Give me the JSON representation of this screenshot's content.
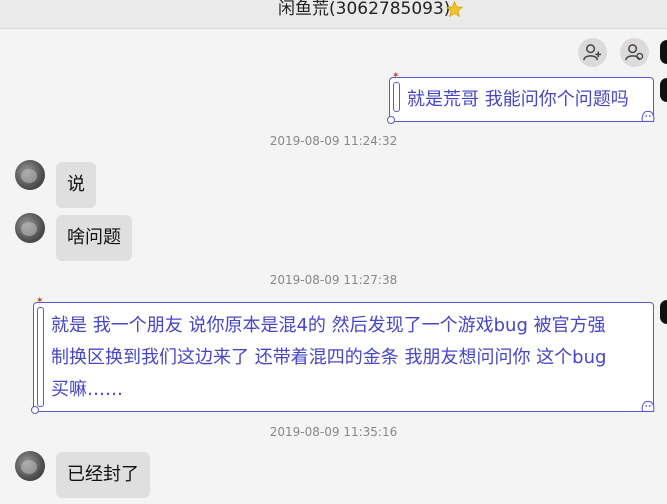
{
  "window": {
    "title": "闲鱼荒(3062785093)",
    "colors": {
      "accent": "#5959d0",
      "text_out": "#4646c8",
      "bubble_in": "#e0dfdf",
      "background": "#f5f4f4"
    }
  },
  "toolbar": {
    "icons": [
      "add-member-icon",
      "group-settings-icon"
    ]
  },
  "messages": [
    {
      "kind": "out",
      "text": "就是荒哥 我能问你个问题吗"
    },
    {
      "kind": "timestamp",
      "text": "2019-08-09 11:24:32"
    },
    {
      "kind": "in",
      "text": "说"
    },
    {
      "kind": "in",
      "text": "啥问题"
    },
    {
      "kind": "timestamp",
      "text": "2019-08-09 11:27:38"
    },
    {
      "kind": "out",
      "lines": [
        "就是 我一个朋友 说你原本是混4的 然后发现了一个游戏bug 被官方强",
        "制换区换到我们这边来了 还带着混四的金条 我朋友想问问你 这个bug",
        "买嘛……"
      ]
    },
    {
      "kind": "timestamp",
      "text": "2019-08-09 11:35:16"
    },
    {
      "kind": "in",
      "text": "已经封了"
    }
  ]
}
